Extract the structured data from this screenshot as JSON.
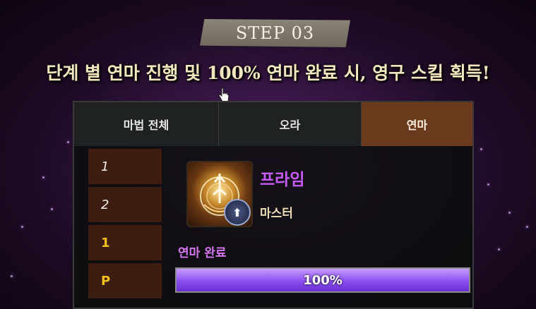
{
  "step": {
    "label": "STEP 03"
  },
  "headline": "단계 별 연마 진행 및 100% 연마 완료 시, 영구 스킬 획득!",
  "tabs": [
    {
      "label": "마법 전체",
      "active": false
    },
    {
      "label": "오라",
      "active": false
    },
    {
      "label": "연마",
      "active": true
    }
  ],
  "levels": [
    "1",
    "2",
    "1",
    "P"
  ],
  "skill": {
    "name": "프라임",
    "rank": "마스터",
    "icon": "prime-skill-icon",
    "upgrade_icon": "upgrade-arrow-icon"
  },
  "mastery": {
    "label": "연마 완료",
    "progress_text": "100%",
    "progress": 1.0
  },
  "colors": {
    "accent_purple": "#c65cf5",
    "active_tab": "#6b3a1c",
    "level_gold": "#f6c21a"
  }
}
